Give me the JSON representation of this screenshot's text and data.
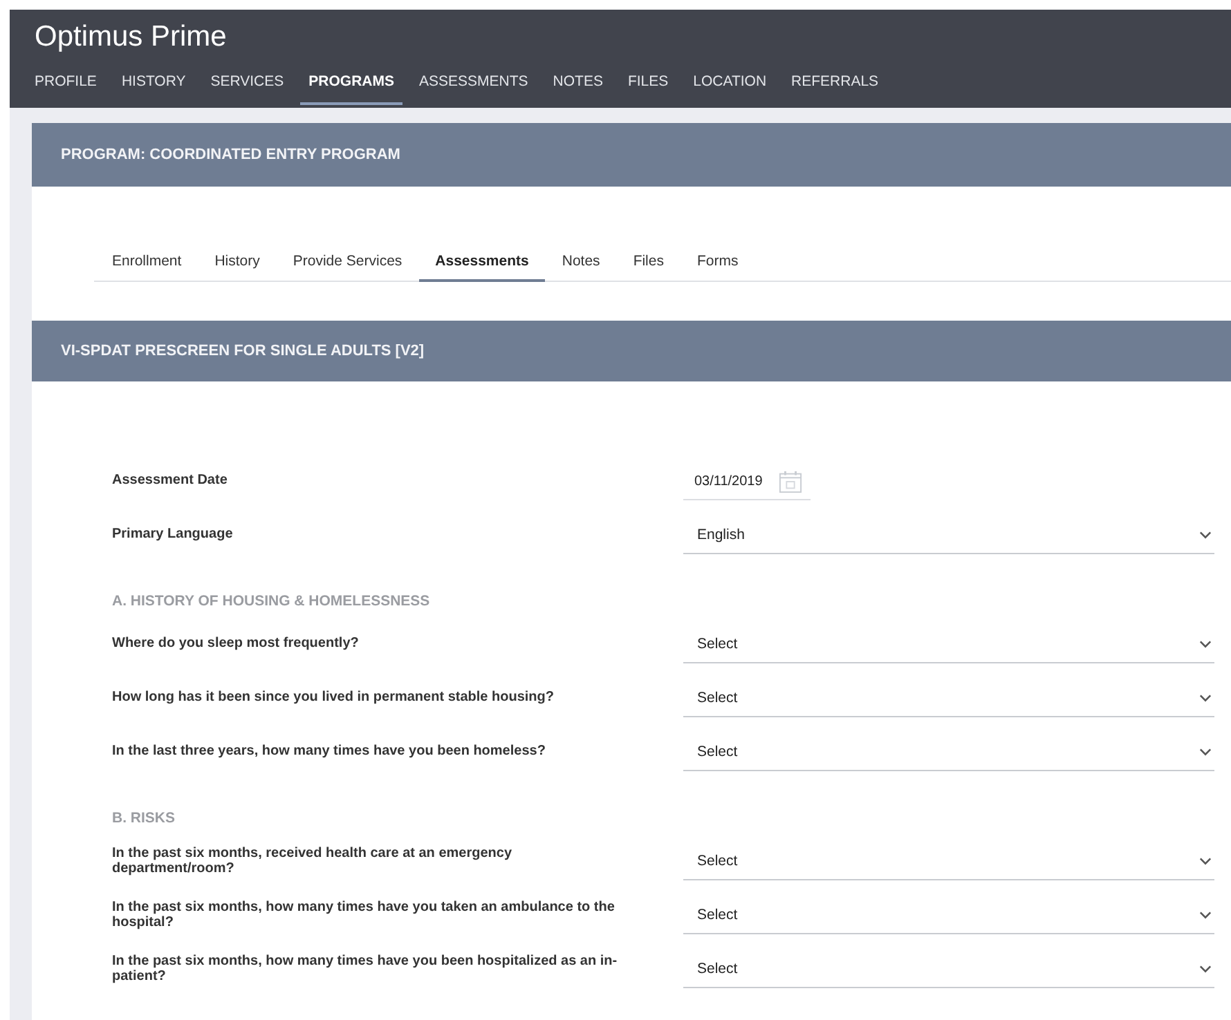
{
  "client": {
    "name": "Optimus Prime"
  },
  "nav_tabs": [
    {
      "label": "PROFILE",
      "selected": false
    },
    {
      "label": "HISTORY",
      "selected": false
    },
    {
      "label": "SERVICES",
      "selected": false
    },
    {
      "label": "PROGRAMS",
      "selected": true
    },
    {
      "label": "ASSESSMENTS",
      "selected": false
    },
    {
      "label": "NOTES",
      "selected": false
    },
    {
      "label": "FILES",
      "selected": false
    },
    {
      "label": "LOCATION",
      "selected": false
    },
    {
      "label": "REFERRALS",
      "selected": false
    }
  ],
  "program_title": "PROGRAM: COORDINATED ENTRY PROGRAM",
  "program_tabs": [
    {
      "label": "Enrollment",
      "selected": false
    },
    {
      "label": "History",
      "selected": false
    },
    {
      "label": "Provide Services",
      "selected": false
    },
    {
      "label": "Assessments",
      "selected": true
    },
    {
      "label": "Notes",
      "selected": false
    },
    {
      "label": "Files",
      "selected": false
    },
    {
      "label": "Forms",
      "selected": false
    }
  ],
  "assessment_title": "VI-SPDAT PRESCREEN FOR SINGLE ADULTS [V2]",
  "items": [
    {
      "kind": "date",
      "label": "Assessment Date",
      "value": "03/11/2019"
    },
    {
      "kind": "select",
      "label": "Primary Language",
      "value": "English"
    },
    {
      "kind": "heading",
      "label": "A. HISTORY OF HOUSING & HOMELESSNESS"
    },
    {
      "kind": "select",
      "label": "Where do you sleep most frequently?",
      "value": "Select"
    },
    {
      "kind": "select",
      "label": "How long has it been since you lived in permanent stable housing?",
      "value": "Select"
    },
    {
      "kind": "select",
      "label": "In the last three years, how many times have you been homeless?",
      "value": "Select"
    },
    {
      "kind": "heading",
      "label": "B. RISKS"
    },
    {
      "kind": "select",
      "label": "In the past six months, received health care at an emergency department/room?",
      "value": "Select"
    },
    {
      "kind": "select",
      "label": "In the past six months, how many times have you taken an ambulance to the hospital?",
      "value": "Select"
    },
    {
      "kind": "select",
      "label": "In the past six months, how many times have you been hospitalized as an in-patient?",
      "value": "Select"
    }
  ]
}
